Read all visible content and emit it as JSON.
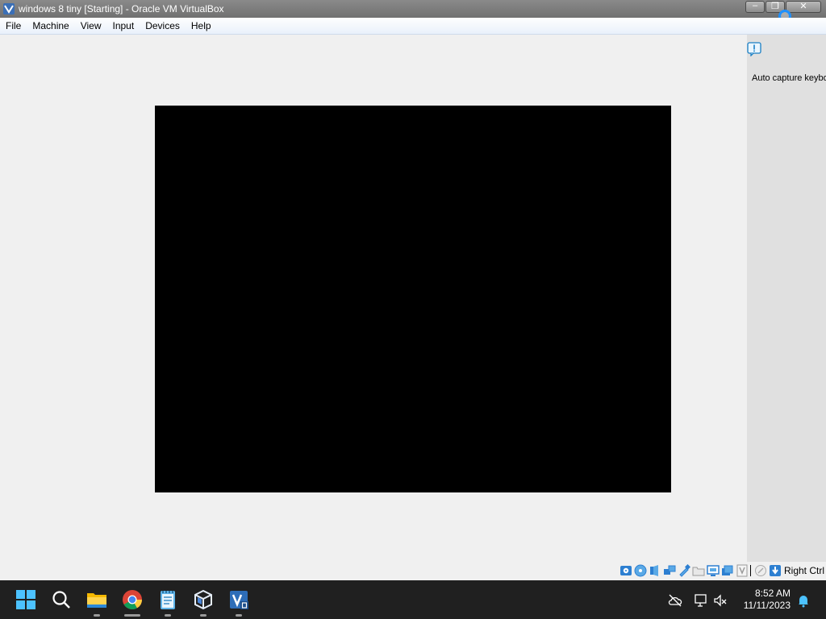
{
  "window": {
    "title": "windows 8 tiny [Starting] - Oracle VM VirtualBox",
    "minimize_glyph": "–",
    "restore_glyph": "❐",
    "close_glyph": "✕"
  },
  "menubar": {
    "items": [
      "File",
      "Machine",
      "View",
      "Input",
      "Devices",
      "Help"
    ]
  },
  "notice": {
    "text": "Auto capture keybo"
  },
  "statusbar": {
    "host_key": "Right Ctrl",
    "icons": [
      "hard-disk-icon",
      "optical-drive-icon",
      "audio-icon",
      "network-icon",
      "usb-icon",
      "shared-folders-icon",
      "display-icon",
      "video-capture-icon",
      "virtualization-icon",
      "mouse-integration-icon",
      "keyboard-capture-icon"
    ]
  },
  "taskbar": {
    "apps": [
      "start-icon",
      "search-icon",
      "file-explorer-icon",
      "chrome-icon",
      "notepad-icon",
      "virtualbox-icon",
      "vm-windows8-icon"
    ],
    "time": "8:52 AM",
    "date": "11/11/2023"
  },
  "colors": {
    "titlebar": "#7c7c7c",
    "vm_screen": "#000000",
    "taskbar": "#202020",
    "accent": "#1e90ff"
  }
}
